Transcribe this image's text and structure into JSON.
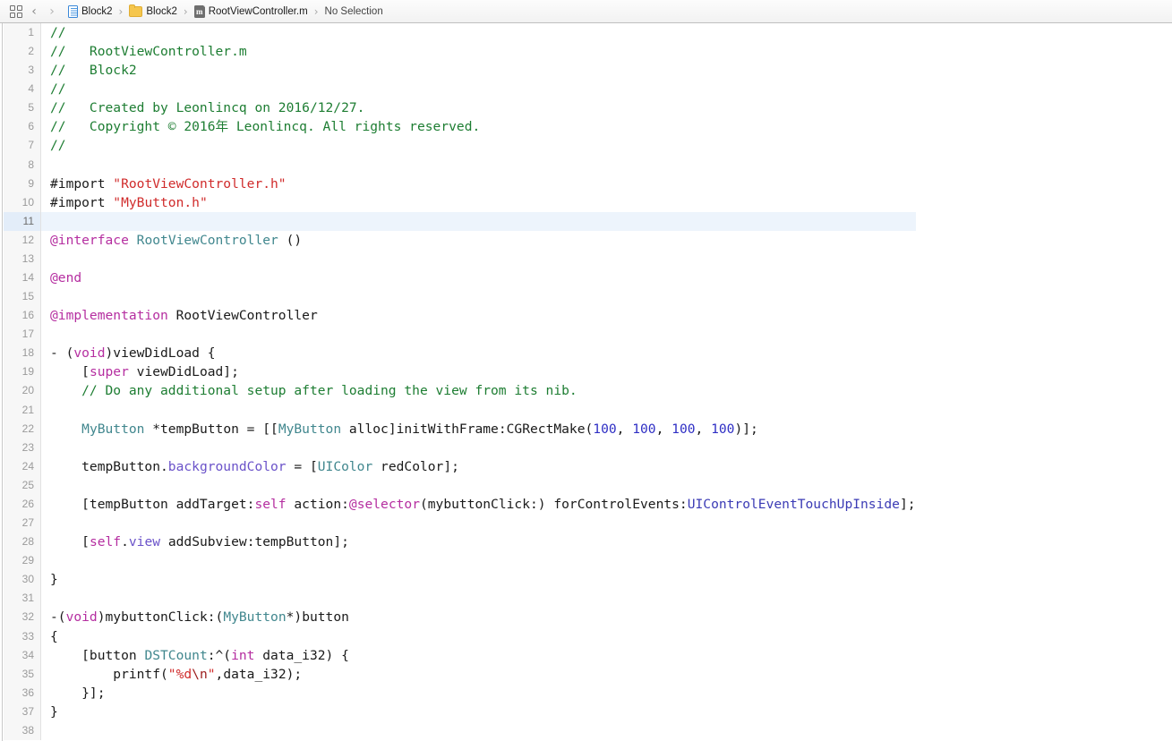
{
  "jump_bar": {
    "grid_icon": "grid-icon",
    "back_icon": "chevron-left-icon",
    "forward_icon": "chevron-right-icon",
    "separator": "›",
    "breadcrumbs": [
      {
        "icon": "project-document-icon",
        "label": "Block2"
      },
      {
        "icon": "folder-icon",
        "label": "Block2"
      },
      {
        "icon": "objc-m-file-icon",
        "label": "RootViewController.m"
      },
      {
        "icon": "none",
        "label": "No Selection"
      }
    ]
  },
  "editor": {
    "language": "objective-c",
    "current_line": 11,
    "total_lines": 38,
    "colors": {
      "comment": "#1d7d32",
      "string": "#d02b2b",
      "escape": "#9b1c1c",
      "keyword": "#b52ea0",
      "number": "#2e2ec4",
      "project_class": "#41878e",
      "property": "#6a52c9",
      "enum_constant": "#3b3bb5",
      "plain": "#1a1a1a",
      "gutter_text": "#9a9a9a",
      "current_line_highlight": "#edf4fc",
      "background": "#ffffff"
    },
    "lines": [
      {
        "n": 1,
        "tokens": [
          {
            "t": "//",
            "c": "cmt"
          }
        ]
      },
      {
        "n": 2,
        "tokens": [
          {
            "t": "//   RootViewController.m",
            "c": "cmt"
          }
        ]
      },
      {
        "n": 3,
        "tokens": [
          {
            "t": "//   Block2",
            "c": "cmt"
          }
        ]
      },
      {
        "n": 4,
        "tokens": [
          {
            "t": "//",
            "c": "cmt"
          }
        ]
      },
      {
        "n": 5,
        "tokens": [
          {
            "t": "//   Created by Leonlincq on 2016/12/27.",
            "c": "cmt"
          }
        ]
      },
      {
        "n": 6,
        "tokens": [
          {
            "t": "//   Copyright © 2016年 Leonlincq. All rights reserved.",
            "c": "cmt"
          }
        ]
      },
      {
        "n": 7,
        "tokens": [
          {
            "t": "//",
            "c": "cmt"
          }
        ]
      },
      {
        "n": 8,
        "tokens": []
      },
      {
        "n": 9,
        "tokens": [
          {
            "t": "#import ",
            "c": "pre"
          },
          {
            "t": "\"RootViewController.h\"",
            "c": "str"
          }
        ]
      },
      {
        "n": 10,
        "tokens": [
          {
            "t": "#import ",
            "c": "pre"
          },
          {
            "t": "\"MyButton.h\"",
            "c": "str"
          }
        ]
      },
      {
        "n": 11,
        "tokens": []
      },
      {
        "n": 12,
        "tokens": [
          {
            "t": "@interface",
            "c": "kw"
          },
          {
            "t": " ",
            "c": "pln"
          },
          {
            "t": "RootViewController",
            "c": "cls"
          },
          {
            "t": " ()",
            "c": "pln"
          }
        ]
      },
      {
        "n": 13,
        "tokens": []
      },
      {
        "n": 14,
        "tokens": [
          {
            "t": "@end",
            "c": "kw"
          }
        ]
      },
      {
        "n": 15,
        "tokens": []
      },
      {
        "n": 16,
        "tokens": [
          {
            "t": "@implementation",
            "c": "kw"
          },
          {
            "t": " RootViewController",
            "c": "pln"
          }
        ]
      },
      {
        "n": 17,
        "tokens": []
      },
      {
        "n": 18,
        "tokens": [
          {
            "t": "- (",
            "c": "pln"
          },
          {
            "t": "void",
            "c": "kw"
          },
          {
            "t": ")viewDidLoad {",
            "c": "pln"
          }
        ]
      },
      {
        "n": 19,
        "tokens": [
          {
            "t": "    [",
            "c": "pln"
          },
          {
            "t": "super",
            "c": "kw"
          },
          {
            "t": " viewDidLoad];",
            "c": "pln"
          }
        ]
      },
      {
        "n": 20,
        "tokens": [
          {
            "t": "    // Do any additional setup after loading the view from its nib.",
            "c": "cmt"
          }
        ]
      },
      {
        "n": 21,
        "tokens": []
      },
      {
        "n": 22,
        "tokens": [
          {
            "t": "    ",
            "c": "pln"
          },
          {
            "t": "MyButton",
            "c": "cls"
          },
          {
            "t": " *tempButton = [[",
            "c": "pln"
          },
          {
            "t": "MyButton",
            "c": "cls"
          },
          {
            "t": " alloc]initWithFrame:CGRectMake(",
            "c": "pln"
          },
          {
            "t": "100",
            "c": "num"
          },
          {
            "t": ", ",
            "c": "pln"
          },
          {
            "t": "100",
            "c": "num"
          },
          {
            "t": ", ",
            "c": "pln"
          },
          {
            "t": "100",
            "c": "num"
          },
          {
            "t": ", ",
            "c": "pln"
          },
          {
            "t": "100",
            "c": "num"
          },
          {
            "t": ")];",
            "c": "pln"
          }
        ]
      },
      {
        "n": 23,
        "tokens": []
      },
      {
        "n": 24,
        "tokens": [
          {
            "t": "    tempButton.",
            "c": "pln"
          },
          {
            "t": "backgroundColor",
            "c": "prop"
          },
          {
            "t": " = [",
            "c": "pln"
          },
          {
            "t": "UIColor",
            "c": "cls"
          },
          {
            "t": " redColor];",
            "c": "pln"
          }
        ]
      },
      {
        "n": 25,
        "tokens": []
      },
      {
        "n": 26,
        "tokens": [
          {
            "t": "    [tempButton addTarget:",
            "c": "pln"
          },
          {
            "t": "self",
            "c": "kw"
          },
          {
            "t": " action:",
            "c": "pln"
          },
          {
            "t": "@selector",
            "c": "kw"
          },
          {
            "t": "(mybuttonClick:) forControlEvents:",
            "c": "pln"
          },
          {
            "t": "UIControlEventTouchUpInside",
            "c": "enm"
          },
          {
            "t": "];",
            "c": "pln"
          }
        ]
      },
      {
        "n": 27,
        "tokens": []
      },
      {
        "n": 28,
        "tokens": [
          {
            "t": "    [",
            "c": "pln"
          },
          {
            "t": "self",
            "c": "kw"
          },
          {
            "t": ".",
            "c": "pln"
          },
          {
            "t": "view",
            "c": "prop"
          },
          {
            "t": " addSubview:tempButton];",
            "c": "pln"
          }
        ]
      },
      {
        "n": 29,
        "tokens": []
      },
      {
        "n": 30,
        "tokens": [
          {
            "t": "}",
            "c": "pln"
          }
        ]
      },
      {
        "n": 31,
        "tokens": []
      },
      {
        "n": 32,
        "tokens": [
          {
            "t": "-(",
            "c": "pln"
          },
          {
            "t": "void",
            "c": "kw"
          },
          {
            "t": ")mybuttonClick:(",
            "c": "pln"
          },
          {
            "t": "MyButton",
            "c": "cls"
          },
          {
            "t": "*)button",
            "c": "pln"
          }
        ]
      },
      {
        "n": 33,
        "tokens": [
          {
            "t": "{",
            "c": "pln"
          }
        ]
      },
      {
        "n": 34,
        "tokens": [
          {
            "t": "    [button ",
            "c": "pln"
          },
          {
            "t": "DSTCount",
            "c": "cls"
          },
          {
            "t": ":^(",
            "c": "pln"
          },
          {
            "t": "int",
            "c": "kw"
          },
          {
            "t": " data_i32) {",
            "c": "pln"
          }
        ]
      },
      {
        "n": 35,
        "tokens": [
          {
            "t": "        printf(",
            "c": "pln"
          },
          {
            "t": "\"%d",
            "c": "str"
          },
          {
            "t": "\\n",
            "c": "esc"
          },
          {
            "t": "\"",
            "c": "str"
          },
          {
            "t": ",data_i32);",
            "c": "pln"
          }
        ]
      },
      {
        "n": 36,
        "tokens": [
          {
            "t": "    }];",
            "c": "pln"
          }
        ]
      },
      {
        "n": 37,
        "tokens": [
          {
            "t": "}",
            "c": "pln"
          }
        ]
      },
      {
        "n": 38,
        "tokens": []
      }
    ]
  }
}
